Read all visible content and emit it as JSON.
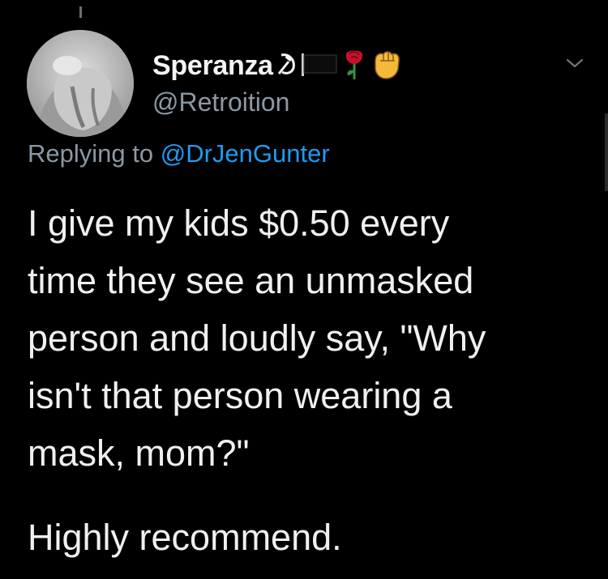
{
  "tweet": {
    "author": {
      "display_name": "Speranza",
      "handle": "@Retroition",
      "name_emojis": [
        "☭",
        "black-flag",
        "🌹",
        "✊"
      ]
    },
    "reply_prefix": "Replying to ",
    "reply_to": "@DrJenGunter",
    "body_lines": [
      "I give my kids $0.50 every",
      "time they see an unmasked",
      "person and loudly say, \"Why",
      "isn't that person wearing a",
      "mask, mom?\""
    ],
    "closing": "Highly recommend."
  },
  "icons": {
    "menu": "chevron-down-icon",
    "avatar": "profile-photo"
  },
  "colors": {
    "background": "#000000",
    "text": "#f0f0f0",
    "secondary": "#8b98a5",
    "link": "#1d9bf0"
  }
}
